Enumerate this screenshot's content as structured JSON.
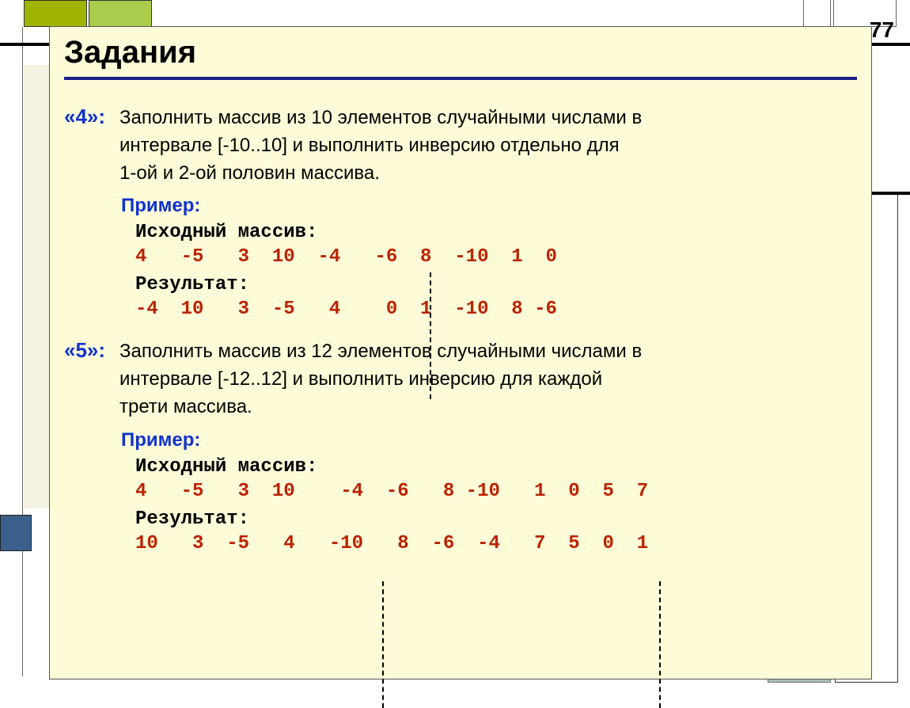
{
  "page_number": "77",
  "title": "Задания",
  "task4": {
    "grade": "«4»:",
    "text1": "Заполнить массив из 10 элементов случайными числами в",
    "text2": "интервале [-10..10] и выполнить инверсию отдельно для",
    "text3": "1-ой и 2-ой половин массива.",
    "example_label": "Пример:",
    "src_label": "Исходный массив:",
    "src_values": "4   -5   3  10  -4   -6  8  -10  1  0",
    "res_label": "Результат:",
    "res_values": "-4  10   3  -5   4    0  1  -10  8 -6"
  },
  "task5": {
    "grade": "«5»:",
    "text1": "Заполнить массив из 12 элементов случайными числами в",
    "text2": "интервале [-12..12] и выполнить инверсию для каждой",
    "text3": "трети массива.",
    "example_label": "Пример:",
    "src_label": "Исходный массив:",
    "src_values": "4   -5   3  10    -4  -6   8 -10   1  0  5  7",
    "res_label": "Результат:",
    "res_values": "10   3  -5   4   -10   8  -6  -4   7  5  0  1"
  }
}
